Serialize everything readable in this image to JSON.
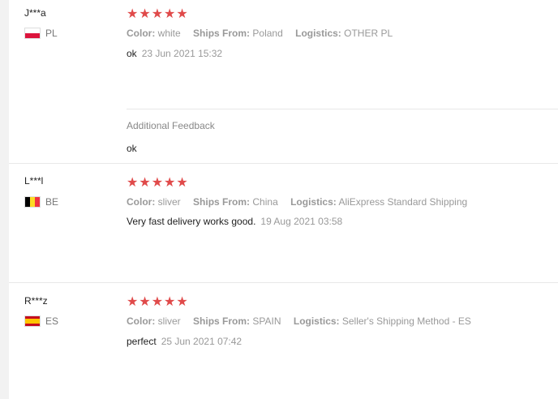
{
  "reviews": [
    {
      "user": "J***a",
      "country": "PL",
      "rating": 5,
      "stars": "★★★★★",
      "color_label": "Color:",
      "color_value": "white",
      "ships_label": "Ships From:",
      "ships_value": "Poland",
      "logistics_label": "Logistics:",
      "logistics_value": "OTHER PL",
      "text": "ok",
      "date": "23 Jun 2021 15:32",
      "additional_title": "Additional Feedback",
      "additional_text": "ok"
    },
    {
      "user": "L***l",
      "country": "BE",
      "rating": 5,
      "stars": "★★★★★",
      "color_label": "Color:",
      "color_value": "sliver",
      "ships_label": "Ships From:",
      "ships_value": "China",
      "logistics_label": "Logistics:",
      "logistics_value": "AliExpress Standard Shipping",
      "text": "Very fast delivery works good.",
      "date": "19 Aug 2021 03:58"
    },
    {
      "user": "R***z",
      "country": "ES",
      "rating": 5,
      "stars": "★★★★★",
      "color_label": "Color:",
      "color_value": "sliver",
      "ships_label": "Ships From:",
      "ships_value": "SPAIN",
      "logistics_label": "Logistics:",
      "logistics_value": "Seller's Shipping Method - ES",
      "text": "perfect",
      "date": "25 Jun 2021 07:42"
    }
  ],
  "colors": {
    "star": "#e04a4a",
    "muted": "#999999"
  }
}
